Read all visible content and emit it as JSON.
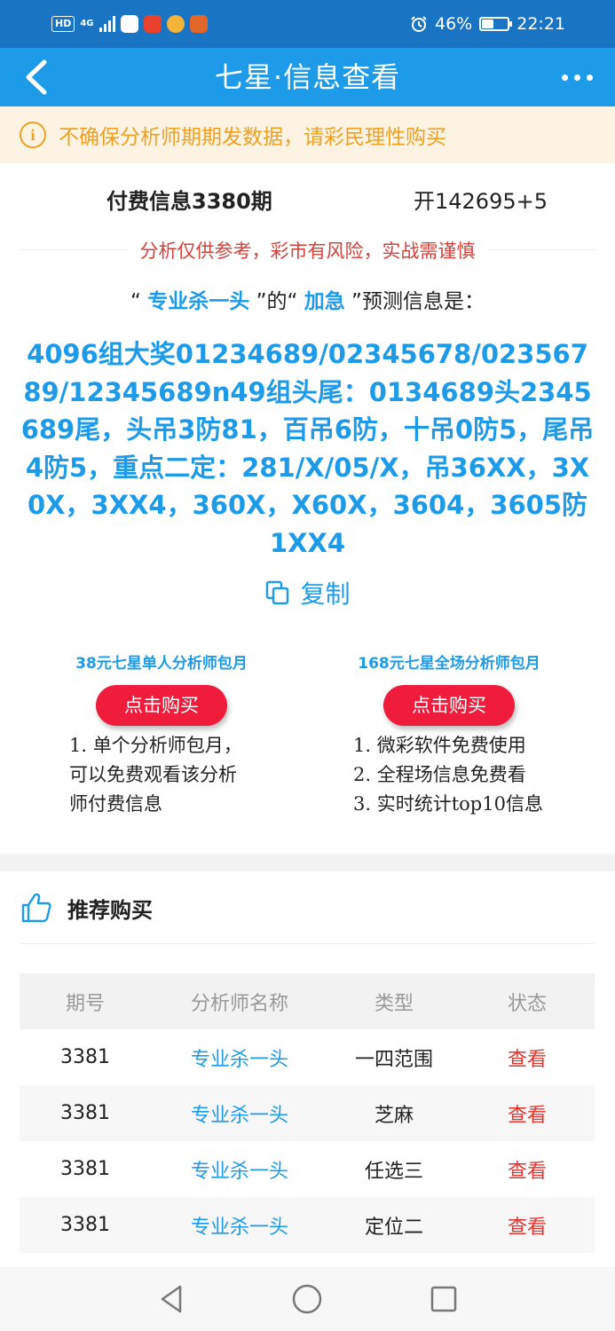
{
  "status_bar": {
    "network_badge": "HD",
    "network_type": "4G",
    "battery_percent": "46%",
    "battery_level": 0.46,
    "time": "22:21"
  },
  "header": {
    "title": "七星·信息查看"
  },
  "notice": {
    "icon_glyph": "i",
    "text": "不确保分析师期期发数据，请彩民理性购买"
  },
  "info": {
    "paid_issue": "付费信息3380期",
    "open_result": "开142695+5",
    "warning": "分析仅供参考，彩市有风险，实战需谨慎",
    "predict_q1": "“",
    "predict_analyst": "专业杀一头",
    "predict_mid": "”的“",
    "predict_type": "加急",
    "predict_tail": "”预测信息是：",
    "content": "4096组大奖01234689/02345678/02356789/12345689n49组头尾：0134689头2345689尾，头吊3防81，百吊6防，十吊0防5，尾吊4防5，重点二定：281/X/05/X，吊36XX，3X0X，3XX4，360X，X60X，3604，3605防1XX4"
  },
  "copy": {
    "label": "复制"
  },
  "packages": [
    {
      "title": "38元七星单人分析师包月",
      "button": "点击购买",
      "desc": [
        "1. 单个分析师包月，",
        "可以免费观看该分析",
        "师付费信息"
      ]
    },
    {
      "title": "168元七星全场分析师包月",
      "button": "点击购买",
      "desc": [
        "1. 微彩软件免费使用",
        "2. 全程场信息免费看",
        "3. 实时统计top10信息"
      ]
    }
  ],
  "recommend": {
    "title": "推荐购买",
    "columns": [
      "期号",
      "分析师名称",
      "类型",
      "状态"
    ],
    "rows": [
      {
        "issue": "3381",
        "analyst": "专业杀一头",
        "type": "一四范围",
        "status": "查看"
      },
      {
        "issue": "3381",
        "analyst": "专业杀一头",
        "type": "芝麻",
        "status": "查看"
      },
      {
        "issue": "3381",
        "analyst": "专业杀一头",
        "type": "任选三",
        "status": "查看"
      },
      {
        "issue": "3381",
        "analyst": "专业杀一头",
        "type": "定位二",
        "status": "查看"
      }
    ]
  },
  "colors": {
    "status_bar": "#1a74c4",
    "title_bar": "#1e9be8",
    "accent_blue": "#1e9be8",
    "notice_orange": "#f0a020",
    "warning_red": "#d2413a",
    "buy_button_red": "#f01c3c",
    "view_red": "#e0342f"
  },
  "icons": {
    "back": "back-arrow-icon",
    "more": "more-dots-icon",
    "notice": "info-circle-icon",
    "copy": "copy-icon",
    "recommend": "thumbs-up-icon",
    "nav_back": "nav-back-triangle-icon",
    "nav_home": "nav-home-circle-icon",
    "nav_recent": "nav-recent-square-icon"
  }
}
